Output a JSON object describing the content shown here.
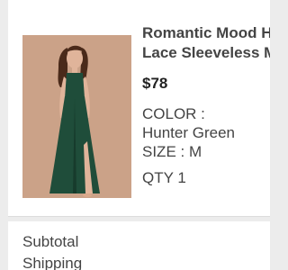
{
  "cart_item": {
    "name_line1": "Romantic Mood H",
    "name_line2": "Lace Sleeveless M",
    "price": "$78",
    "color_label": "COLOR :",
    "color_value": "Hunter Green",
    "size_text": "SIZE : M",
    "qty_text": "QTY 1",
    "image_icon": "dress-photo",
    "dress_color": "#1f4d3a",
    "background_color": "#cba288"
  },
  "summary": {
    "subtotal_label": "Subtotal",
    "shipping_label": "Shipping"
  }
}
